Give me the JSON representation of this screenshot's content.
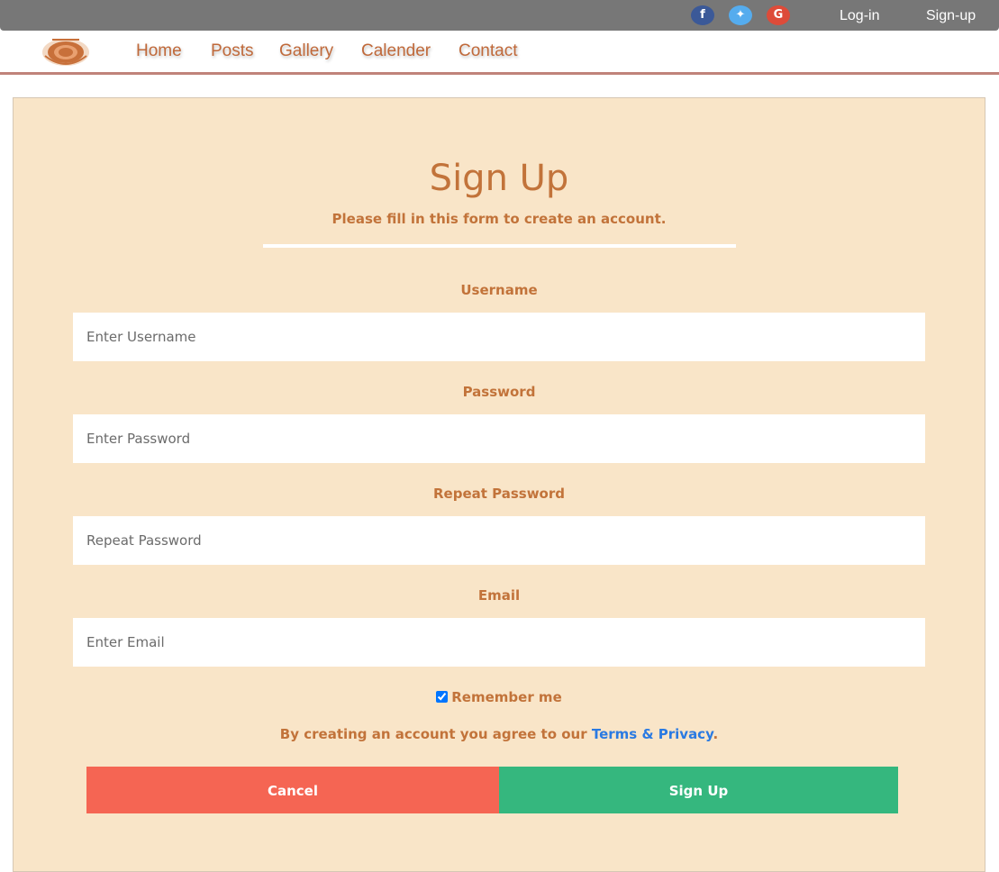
{
  "topbar": {
    "social": [
      {
        "icon": "facebook-icon",
        "glyph": "f",
        "color": "#3b5998"
      },
      {
        "icon": "twitter-icon",
        "glyph": "✦",
        "color": "#55acee"
      },
      {
        "icon": "google-icon",
        "glyph": "G",
        "color": "#dd4b39"
      }
    ],
    "login_label": "Log-in",
    "signup_label": "Sign-up"
  },
  "nav": {
    "items": [
      "Home",
      "Posts",
      "Gallery",
      "Calender",
      "Contact"
    ]
  },
  "form": {
    "title": "Sign Up",
    "subtitle": "Please fill in this form to create an account.",
    "fields": [
      {
        "label": "Username",
        "placeholder": "Enter Username",
        "value": ""
      },
      {
        "label": "Password",
        "placeholder": "Enter Password",
        "value": ""
      },
      {
        "label": "Repeat Password",
        "placeholder": "Repeat Password",
        "value": ""
      },
      {
        "label": "Email",
        "placeholder": "Enter Email",
        "value": ""
      }
    ],
    "remember_label": "Remember me",
    "remember_checked": true,
    "terms_prefix": "By creating an account you agree to our ",
    "terms_link": "Terms & Privacy",
    "terms_suffix": ".",
    "cancel_label": "Cancel",
    "submit_label": "Sign Up"
  },
  "colors": {
    "accent": "#c2733a",
    "card_bg": "#f9e5c8",
    "cancel": "#f56553",
    "submit": "#35b77e",
    "link": "#2a7ae2"
  }
}
